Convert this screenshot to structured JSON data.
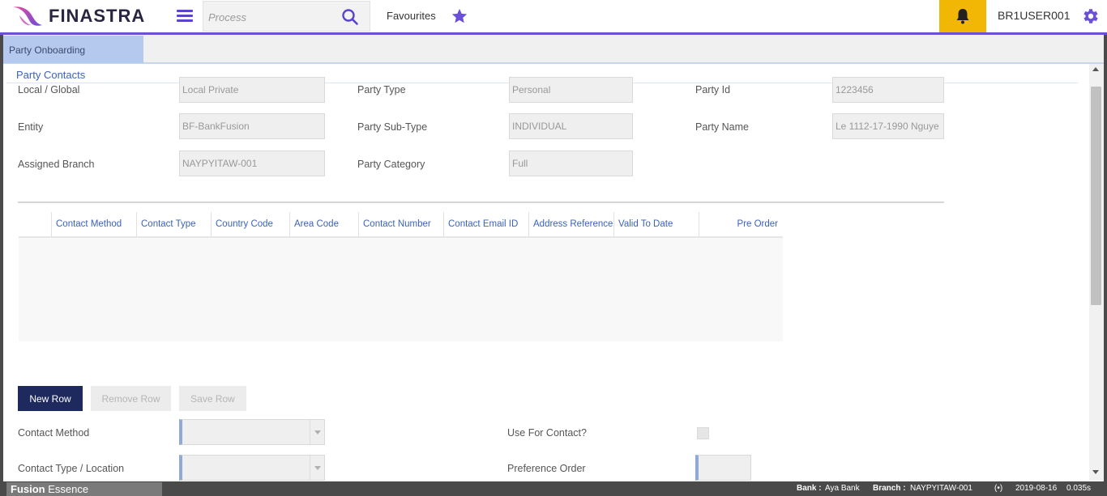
{
  "app": {
    "logo_text": "FINASTRA",
    "search_placeholder": "Process",
    "favourites_label": "Favourites",
    "user": "BR1USER001",
    "colors": {
      "accent": "#6b4fd6",
      "bell_bg": "#f2b705",
      "primary_button": "#1e2a5e",
      "link_blue": "#3b63b8"
    }
  },
  "tabs": [
    {
      "label": "Party Onboarding",
      "active": true
    }
  ],
  "section": {
    "title": "Party Contacts"
  },
  "fields": {
    "local_global": {
      "label": "Local / Global",
      "value": "Local Private"
    },
    "party_type": {
      "label": "Party Type",
      "value": "Personal"
    },
    "party_id": {
      "label": "Party Id",
      "value": "1223456"
    },
    "entity": {
      "label": "Entity",
      "value": "BF-BankFusion"
    },
    "party_sub_type": {
      "label": "Party Sub-Type",
      "value": "INDIVIDUAL"
    },
    "party_name": {
      "label": "Party Name",
      "value": "Le 1112-17-1990 Nguye"
    },
    "assigned_branch": {
      "label": "Assigned Branch",
      "value": "NAYPYITAW-001"
    },
    "party_category": {
      "label": "Party Category",
      "value": "Full"
    }
  },
  "grid": {
    "columns": [
      "Contact Method",
      "Contact Type",
      "Country Code",
      "Area Code",
      "Contact Number",
      "Contact Email ID",
      "Address Reference",
      "Valid To Date",
      "Pre Order"
    ],
    "rows": []
  },
  "buttons": {
    "new_row": "New Row",
    "remove_row": "Remove Row",
    "save_row": "Save Row"
  },
  "detail": {
    "contact_method": {
      "label": "Contact Method",
      "value": ""
    },
    "contact_type_location": {
      "label": "Contact Type / Location",
      "value": ""
    },
    "use_for_contact": {
      "label": "Use For Contact?",
      "checked": false
    },
    "preference_order": {
      "label": "Preference Order",
      "value": ""
    }
  },
  "status": {
    "brand_bold": "Fusion",
    "brand_rest": " Essence",
    "bank_label": "Bank :",
    "bank_value": "Aya Bank",
    "branch_label": "Branch :",
    "branch_value": "NAYPYITAW-001",
    "signal_icon": "(•)",
    "date": "2019-08-16",
    "time": "0.035s"
  }
}
